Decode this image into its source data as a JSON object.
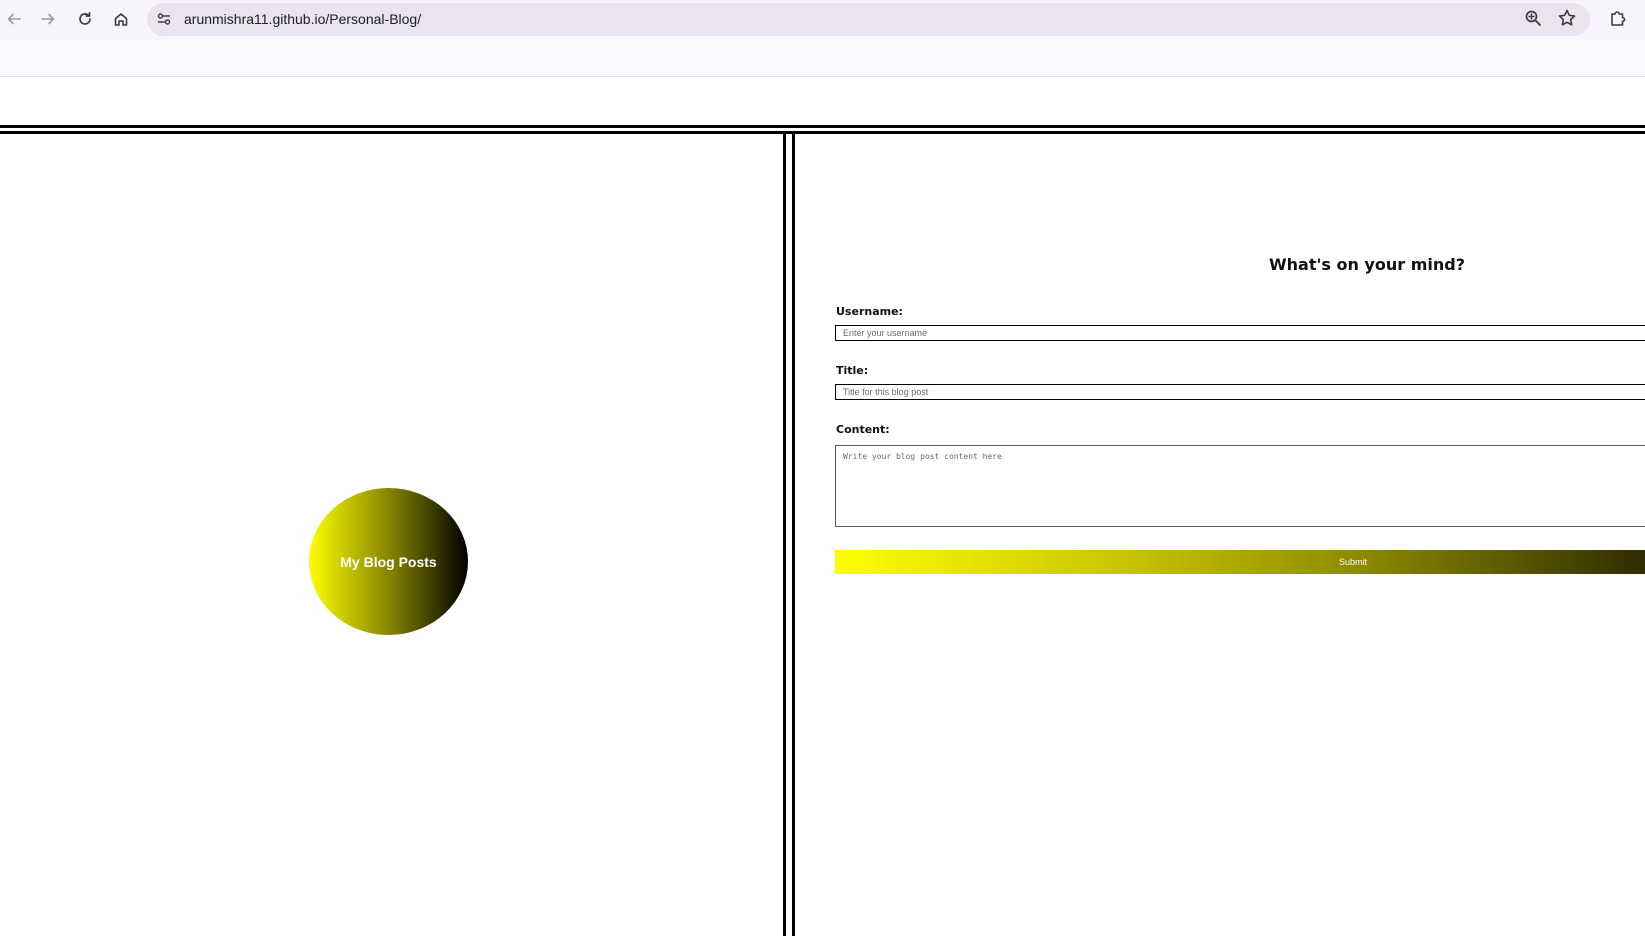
{
  "browser": {
    "url": "arunmishra11.github.io/Personal-Blog/"
  },
  "left_panel": {
    "blog_posts_button": "My Blog Posts"
  },
  "form": {
    "title": "What's on your mind?",
    "username_label": "Username:",
    "username_placeholder": "Enter your username",
    "title_label": "Title:",
    "title_placeholder": "Title for this blog post",
    "content_label": "Content:",
    "content_placeholder": "Write your blog post content here",
    "submit_label": "Submit"
  },
  "colors": {
    "gradient_start": "#ffff00",
    "gradient_end": "#000000",
    "border": "#000000"
  },
  "icons": [
    "back-arrow-icon",
    "forward-arrow-icon",
    "reload-icon",
    "home-icon",
    "site-info-icon",
    "zoom-icon",
    "bookmark-star-icon",
    "extensions-icon"
  ]
}
